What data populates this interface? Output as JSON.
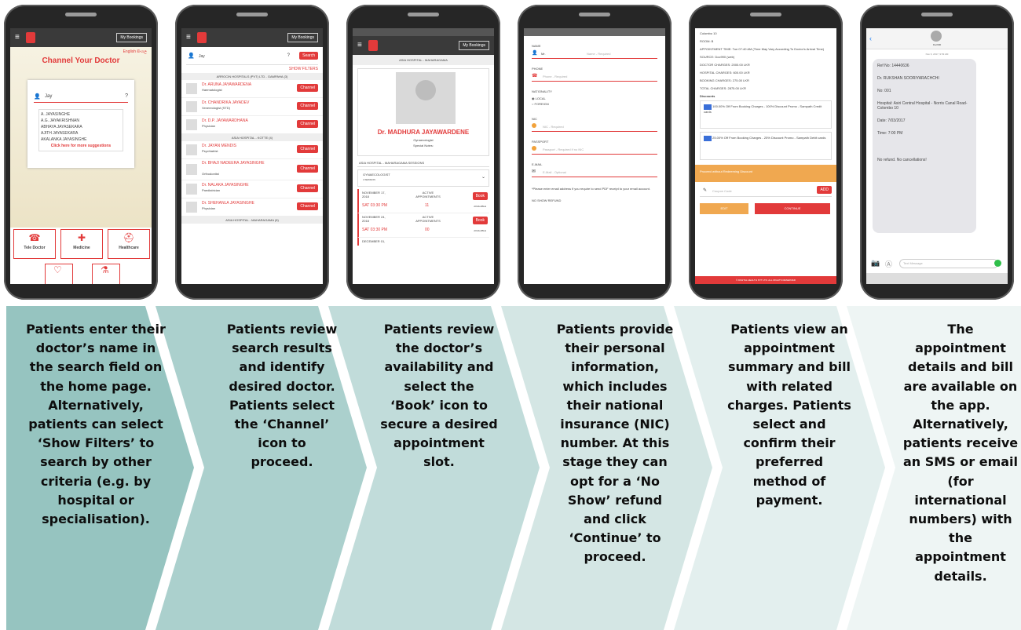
{
  "screens": {
    "s1": {
      "bookings": "My Bookings",
      "lang": "English  සිංහල",
      "title": "Channel Your Doctor",
      "search_value": "Jay",
      "suggestions": [
        "A. JAYASINGHE",
        "A.G. JAYAKRISHNAN",
        "ABHAYA JAYASEKARA",
        "AJITH JAYASEKARA",
        "AKALANKA JAYASINGHE"
      ],
      "more_link": "Click here for more suggestions",
      "tiles": [
        {
          "label": "Tele Doctor"
        },
        {
          "label": "Medicine"
        },
        {
          "label": "Healthcare"
        }
      ]
    },
    "s2": {
      "bookings": "My Bookings",
      "search_value": "Jay",
      "search_btn": "Search",
      "filters": "SHOW FILTERS",
      "sections": [
        "ARROCIN HOSPITALS (PVT) LTD - GAMPAHA (3)",
        "ASIA HOSPITAL - KOTTE (4)",
        "ASIA HOSPITAL - MAHARAGAMA (8)"
      ],
      "doctors": [
        {
          "name": "Dr. ARUNA JAYAWARDENA",
          "spec": "Haematologist"
        },
        {
          "name": "Dr. CHANDRIKA JAYADEV",
          "spec": "Venereologist (STD)"
        },
        {
          "name": "Dr. D.P. JAYAWARDHANA",
          "spec": "Physician"
        },
        {
          "name": "Dr. JAYAN MENDIS",
          "spec": "Psychiatrist"
        },
        {
          "name": "Dr. BHAJI NADEERA JAYASINGHE",
          "spec": "Orthodontist"
        },
        {
          "name": "Dr. NALAKA JAYASINGHE",
          "spec": "Paediatrician"
        },
        {
          "name": "Dr. SHEHANLA JAYASINGHE",
          "spec": "Physician"
        }
      ],
      "channel_btn": "Channel"
    },
    "s3": {
      "bookings": "My Bookings",
      "hospital": "ASIA HOSPITAL - MAHARAGAMA",
      "doctor": "Dr. MADHURA JAYAWARDENE",
      "spec": "Gynaecologist",
      "notes": "Special Notes:",
      "session_bar": "ASIA HOSPITAL - MAHARAGAMA SESSIONS",
      "category": "GYNAECOLOGIST",
      "category_sub": "4 SESSION",
      "slots": [
        {
          "date": "NOVEMBER 17, 2018",
          "time": "SAT 03:30 PM",
          "label": "ACTIVE APPOINTMENTS",
          "count": "11"
        },
        {
          "date": "NOVEMBER 24, 2018",
          "time": "SAT 03:30 PM",
          "label": "ACTIVE APPOINTMENTS",
          "count": "00"
        },
        {
          "date": "DECEMBER 01,",
          "time": "",
          "label": "",
          "count": ""
        }
      ],
      "book_btn": "Book",
      "avail": "AVAILABLE"
    },
    "s4": {
      "name_label": "NAME",
      "title_value": "Mr.",
      "name_ph": "Name - Required",
      "phone_label": "PHONE",
      "phone_ph": "Phone - Required",
      "nat_label": "NATIONALITY",
      "nat_local": "LOCAL",
      "nat_foreign": "FOREIGN",
      "nic_label": "NIC",
      "nic_ph": "NIC - Required",
      "pass_label": "PASSPORT",
      "pass_ph": "Passport - Required if no NIC",
      "email_label": "E-MAIL",
      "email_ph": "E-Mail - Optional",
      "note": "*Please enter email address if you require to send PDF receipt to your email account.",
      "noshow": "NO SHOW REFUND"
    },
    "s5": {
      "lines": [
        "Colombo 10",
        "ROOM: B",
        "APPOINTMENT TIME: Tue 07:40 AM (Time May Vary According To Doctor's Arrival Time)",
        "SOURCE: Doc990 (web)",
        "DOCTOR CHARGES: 2000.00 LKR",
        "HOSPITAL CHARGES: 600.00 LKR",
        "BOOKING CHARGES: 275.00 LKR",
        "TOTAL CHARGES: 2875.00 LKR",
        "Discounts"
      ],
      "disc1": "100.00% Off From Booking Charges - 100% Discount Promo - Sampath Credit cards",
      "disc2": "25.00% Off From Booking Charges - 25% Discount Promo - Sampath Debit cards",
      "proceed": "Proceed without Redeeming Discount",
      "coupon_ph": "Coupon Code",
      "add": "ADD",
      "edit": "EDIT",
      "continue": "CONTINUE",
      "footer": "© DIGITAL HEALTH PVT LTD. ALL RIGHTS RESERVED"
    },
    "s6": {
      "contact": "Doc990",
      "date": "Nov 6, 2017, 9:53 AM",
      "sms": [
        "Ref No: 14440636",
        "Dr. RUKSHAN SOORIYARACHCHI",
        "No: 001",
        "Hospital: Asiri Central Hospital - Norris Canal Road-Colombo 10",
        "Date: 7/03/2017",
        "Time: 7:00 PM",
        "No refund. No cancellations!"
      ],
      "input_ph": "Text Message"
    }
  },
  "steps": [
    {
      "text": "Patients enter their doctor’s name in the search field on the home page. Alternatively, patients can select ‘Show Filters’ to search by other criteria (e.g. by hospital or specialisation).",
      "color": "#96c4c0"
    },
    {
      "text": "Patients review search results and identify desired doctor. Patients select the ‘Channel’ icon to proceed.",
      "color": "#abd0cd"
    },
    {
      "text": "Patients review the doctor’s availability and select the ‘Book’ icon to secure a desired appointment slot.",
      "color": "#c1dcda"
    },
    {
      "text": "Patients provide their personal information, which includes their national insurance (NIC) number. At this stage they can opt for a ‘No Show’ refund and click ‘Continue’ to proceed.",
      "color": "#d4e6e4"
    },
    {
      "text": "Patients view an appointment summary and bill with related charges. Patients select and confirm their preferred method of payment.",
      "color": "#e3efee"
    },
    {
      "text": "The appointment details and bill are available on the app. Alternatively, patients receive an SMS or email (for international numbers) with the appointment details.",
      "color": "#eef5f4"
    }
  ]
}
